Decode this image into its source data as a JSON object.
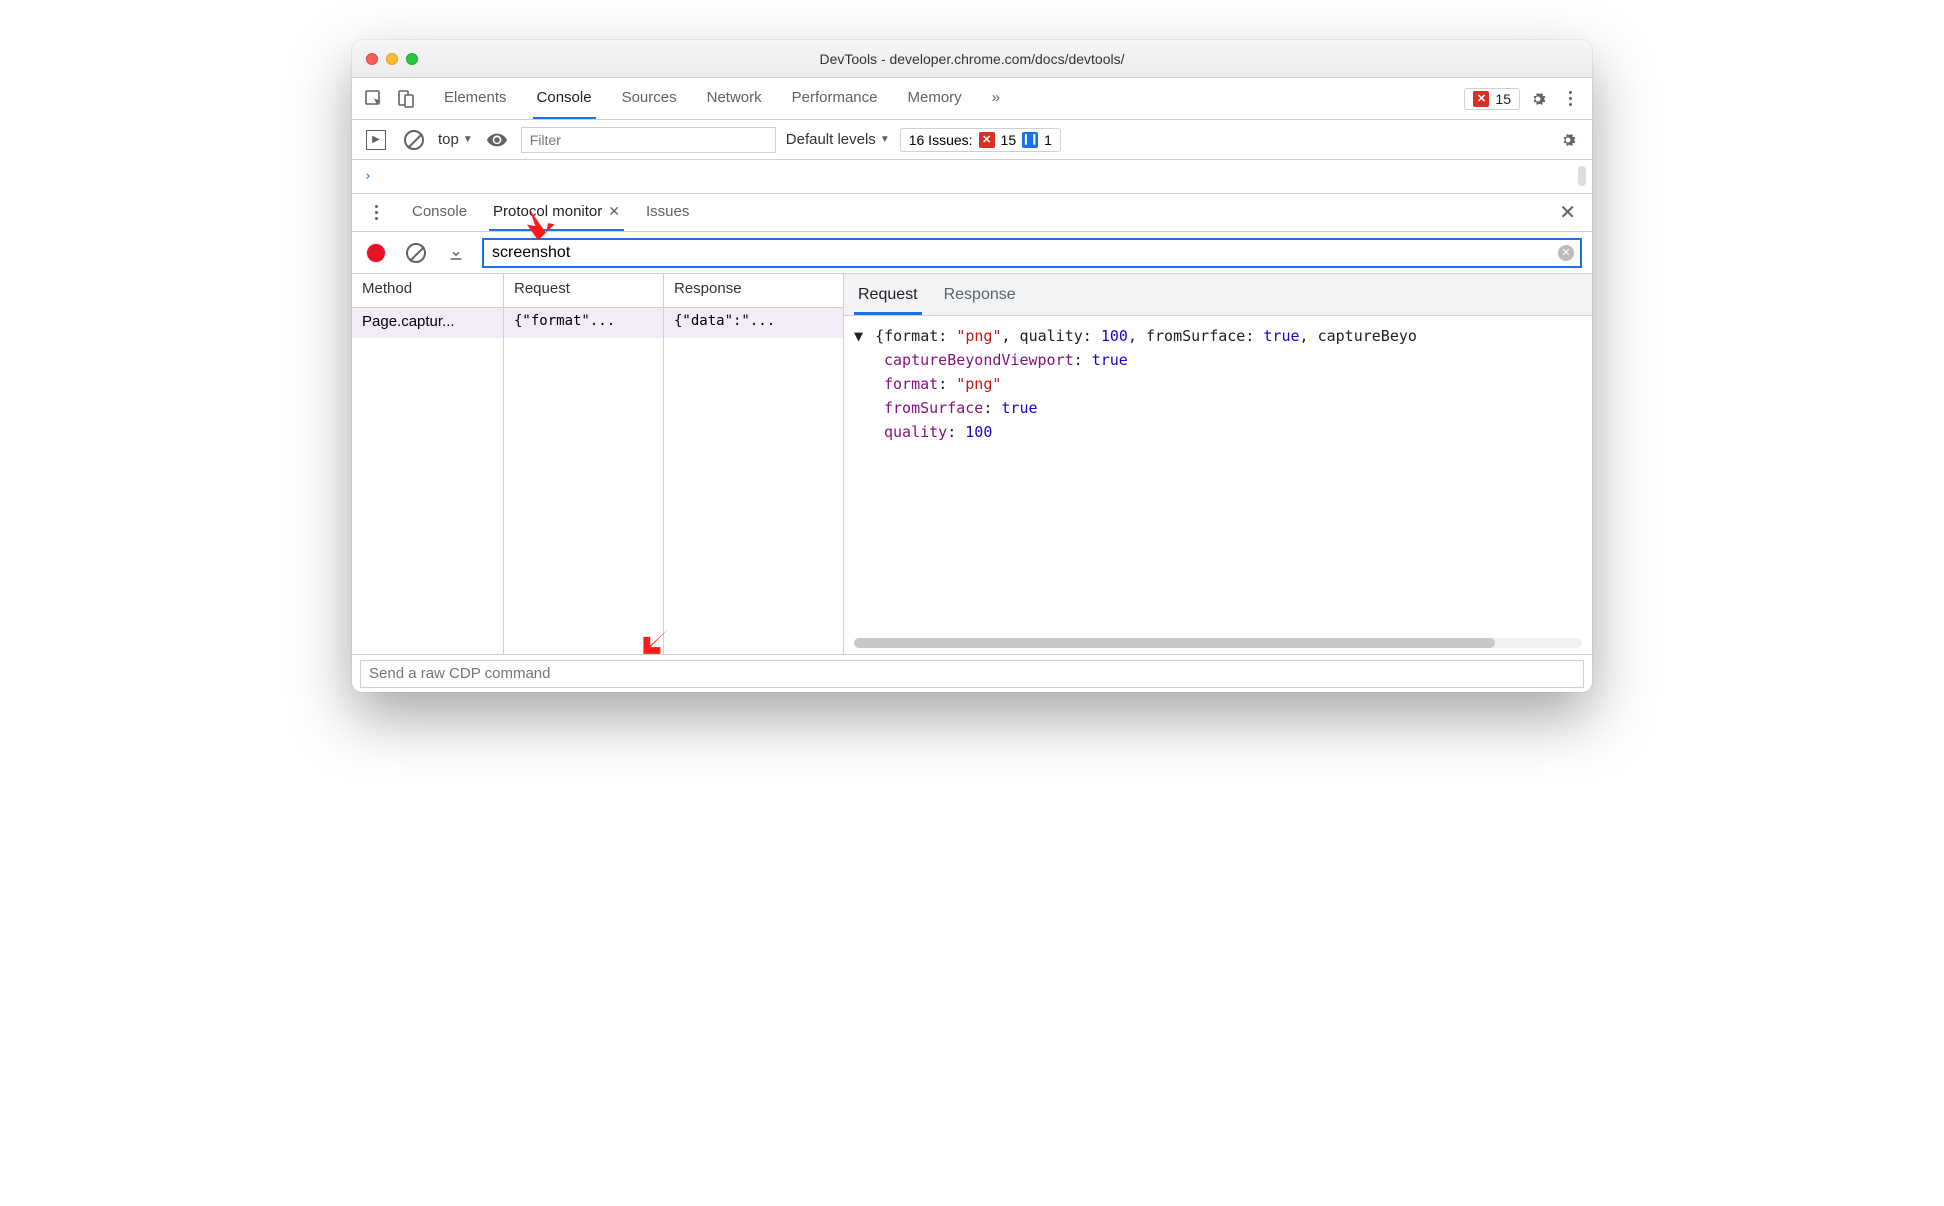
{
  "window": {
    "title": "DevTools - developer.chrome.com/docs/devtools/"
  },
  "mainTabs": {
    "items": [
      "Elements",
      "Console",
      "Sources",
      "Network",
      "Performance",
      "Memory"
    ],
    "overflow": "»",
    "activeIndex": 1,
    "errorCount": "15"
  },
  "consoleToolbar": {
    "context": "top",
    "filterPlaceholder": "Filter",
    "levels": "Default levels",
    "issuesLabel": "16 Issues:",
    "issuesErrors": "15",
    "issuesInfo": "1"
  },
  "consolePrompt": "›",
  "drawer": {
    "tabs": [
      "Console",
      "Protocol monitor",
      "Issues"
    ],
    "activeIndex": 1
  },
  "protocolMonitor": {
    "filterValue": "screenshot",
    "columns": [
      "Method",
      "Request",
      "Response"
    ],
    "rows": [
      {
        "method": "Page.captur...",
        "request": "{\"format\"...",
        "response": "{\"data\":\"..."
      }
    ],
    "detailTabs": [
      "Request",
      "Response"
    ],
    "detailActiveIndex": 0,
    "requestJson": {
      "summaryPrefix": "{format: ",
      "summaryFormat": "\"png\"",
      "summaryMid1": ", quality: ",
      "summaryQuality": "100",
      "summaryMid2": ", fromSurface: ",
      "summaryFromSurface": "true",
      "summaryMid3": ", captureBeyo",
      "props": [
        {
          "k": "captureBeyondViewport",
          "v": "true",
          "t": "bool"
        },
        {
          "k": "format",
          "v": "\"png\"",
          "t": "str"
        },
        {
          "k": "fromSurface",
          "v": "true",
          "t": "bool"
        },
        {
          "k": "quality",
          "v": "100",
          "t": "num"
        }
      ]
    },
    "cdpPlaceholder": "Send a raw CDP command"
  }
}
